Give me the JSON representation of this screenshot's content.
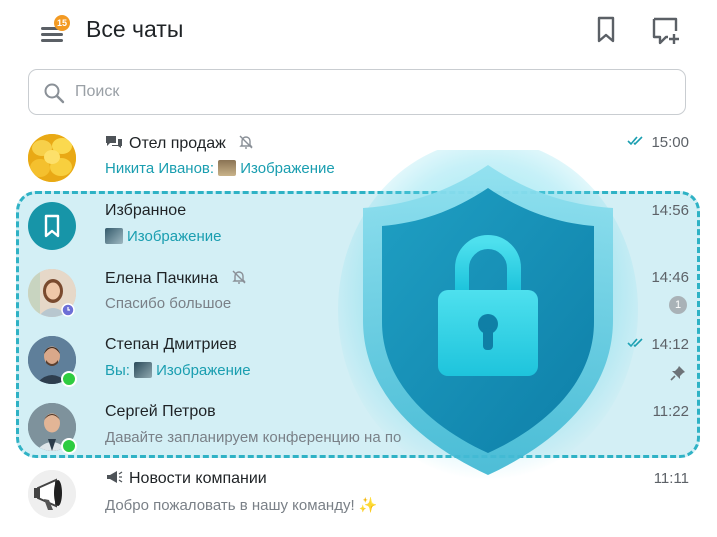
{
  "header": {
    "title": "Все чаты",
    "menu_badge": "15"
  },
  "search": {
    "placeholder": "Поиск"
  },
  "chats": [
    {
      "name": "Отел продаж",
      "sender": "Никита Иванов:",
      "message": "Изображение",
      "time": "15:00"
    },
    {
      "name": "Избранное",
      "message": "Изображение",
      "time": "14:56"
    },
    {
      "name": "Елена Пачкина",
      "message": "Спасибо большое",
      "time": "14:46",
      "unread": "1"
    },
    {
      "name": "Степан Дмитриев",
      "sender": "Вы:",
      "message": "Изображение",
      "time": "14:12"
    },
    {
      "name": "Сергей Петров",
      "message": "Давайте запланируем конференцию на по",
      "time": "11:22"
    },
    {
      "name": "Новости компании",
      "message": "Добро пожаловать в нашу команду! ✨",
      "time": "11:11"
    }
  ],
  "colors": {
    "accent": "#1a9eb0",
    "highlight": "#aee2ec",
    "online": "#2ecc40",
    "badge": "#f39a23",
    "shield": "#1fa5c6"
  },
  "icons": [
    "menu-icon",
    "bookmark-icon",
    "new-chat-icon",
    "search-icon",
    "mute-icon",
    "double-check-icon",
    "pin-icon",
    "megaphone-icon",
    "chat-group-icon",
    "lock-icon",
    "shield-icon"
  ]
}
